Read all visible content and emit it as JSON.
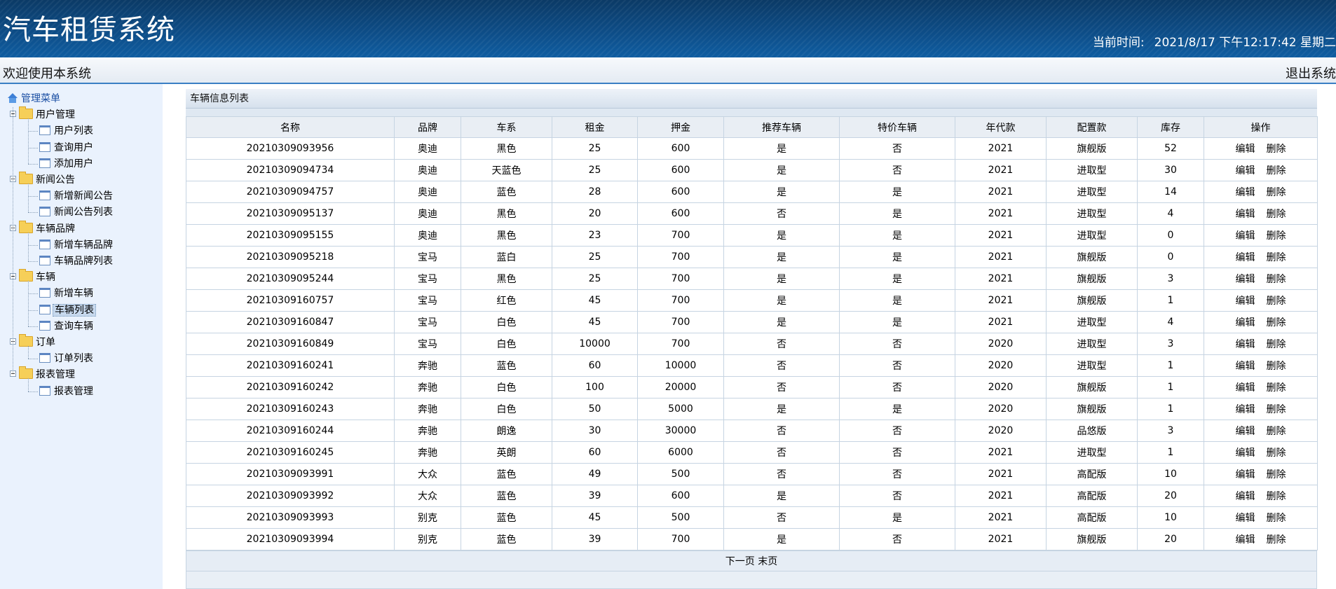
{
  "header": {
    "title": "汽车租赁系统",
    "time_label": "当前时间:",
    "time_value": "2021/8/17 下午12:17:42 星期二"
  },
  "welcome": {
    "text": "欢迎使用本系统",
    "logout": "退出系统"
  },
  "sidebar": {
    "root": "管理菜单",
    "groups": [
      {
        "label": "用户管理",
        "items": [
          "用户列表",
          "查询用户",
          "添加用户"
        ]
      },
      {
        "label": "新闻公告",
        "items": [
          "新增新闻公告",
          "新闻公告列表"
        ]
      },
      {
        "label": "车辆品牌",
        "items": [
          "新增车辆品牌",
          "车辆品牌列表"
        ]
      },
      {
        "label": "车辆",
        "items": [
          "新增车辆",
          "车辆列表",
          "查询车辆"
        ]
      },
      {
        "label": "订单",
        "items": [
          "订单列表"
        ]
      },
      {
        "label": "报表管理",
        "items": [
          "报表管理"
        ]
      }
    ],
    "selected": "车辆列表"
  },
  "panel": {
    "title": "车辆信息列表"
  },
  "table": {
    "columns": [
      "名称",
      "品牌",
      "车系",
      "租金",
      "押金",
      "推荐车辆",
      "特价车辆",
      "年代款",
      "配置款",
      "库存",
      "操作"
    ],
    "edit_label": "编辑",
    "delete_label": "删除",
    "rows": [
      [
        "20210309093956",
        "奥迪",
        "黑色",
        "25",
        "600",
        "是",
        "否",
        "2021",
        "旗舰版",
        "52"
      ],
      [
        "20210309094734",
        "奥迪",
        "天蓝色",
        "25",
        "600",
        "是",
        "否",
        "2021",
        "进取型",
        "30"
      ],
      [
        "20210309094757",
        "奥迪",
        "蓝色",
        "28",
        "600",
        "是",
        "是",
        "2021",
        "进取型",
        "14"
      ],
      [
        "20210309095137",
        "奥迪",
        "黑色",
        "20",
        "600",
        "否",
        "是",
        "2021",
        "进取型",
        "4"
      ],
      [
        "20210309095155",
        "奥迪",
        "黑色",
        "23",
        "700",
        "是",
        "是",
        "2021",
        "进取型",
        "0"
      ],
      [
        "20210309095218",
        "宝马",
        "蓝白",
        "25",
        "700",
        "是",
        "是",
        "2021",
        "旗舰版",
        "0"
      ],
      [
        "20210309095244",
        "宝马",
        "黑色",
        "25",
        "700",
        "是",
        "是",
        "2021",
        "旗舰版",
        "3"
      ],
      [
        "20210309160757",
        "宝马",
        "红色",
        "45",
        "700",
        "是",
        "是",
        "2021",
        "旗舰版",
        "1"
      ],
      [
        "20210309160847",
        "宝马",
        "白色",
        "45",
        "700",
        "是",
        "是",
        "2021",
        "进取型",
        "4"
      ],
      [
        "20210309160849",
        "宝马",
        "白色",
        "10000",
        "700",
        "否",
        "否",
        "2020",
        "进取型",
        "3"
      ],
      [
        "20210309160241",
        "奔驰",
        "蓝色",
        "60",
        "10000",
        "否",
        "否",
        "2020",
        "进取型",
        "1"
      ],
      [
        "20210309160242",
        "奔驰",
        "白色",
        "100",
        "20000",
        "否",
        "否",
        "2020",
        "旗舰版",
        "1"
      ],
      [
        "20210309160243",
        "奔驰",
        "白色",
        "50",
        "5000",
        "是",
        "是",
        "2020",
        "旗舰版",
        "1"
      ],
      [
        "20210309160244",
        "奔驰",
        "朗逸",
        "30",
        "30000",
        "否",
        "否",
        "2020",
        "品悠版",
        "3"
      ],
      [
        "20210309160245",
        "奔驰",
        "英朗",
        "60",
        "6000",
        "否",
        "否",
        "2021",
        "进取型",
        "1"
      ],
      [
        "20210309093991",
        "大众",
        "蓝色",
        "49",
        "500",
        "否",
        "否",
        "2021",
        "高配版",
        "10"
      ],
      [
        "20210309093992",
        "大众",
        "蓝色",
        "39",
        "600",
        "是",
        "否",
        "2021",
        "高配版",
        "20"
      ],
      [
        "20210309093993",
        "别克",
        "蓝色",
        "45",
        "500",
        "否",
        "是",
        "2021",
        "高配版",
        "10"
      ],
      [
        "20210309093994",
        "别克",
        "蓝色",
        "39",
        "700",
        "是",
        "否",
        "2021",
        "旗舰版",
        "20"
      ]
    ]
  },
  "pager": {
    "next": "下一页",
    "last": "末页"
  }
}
